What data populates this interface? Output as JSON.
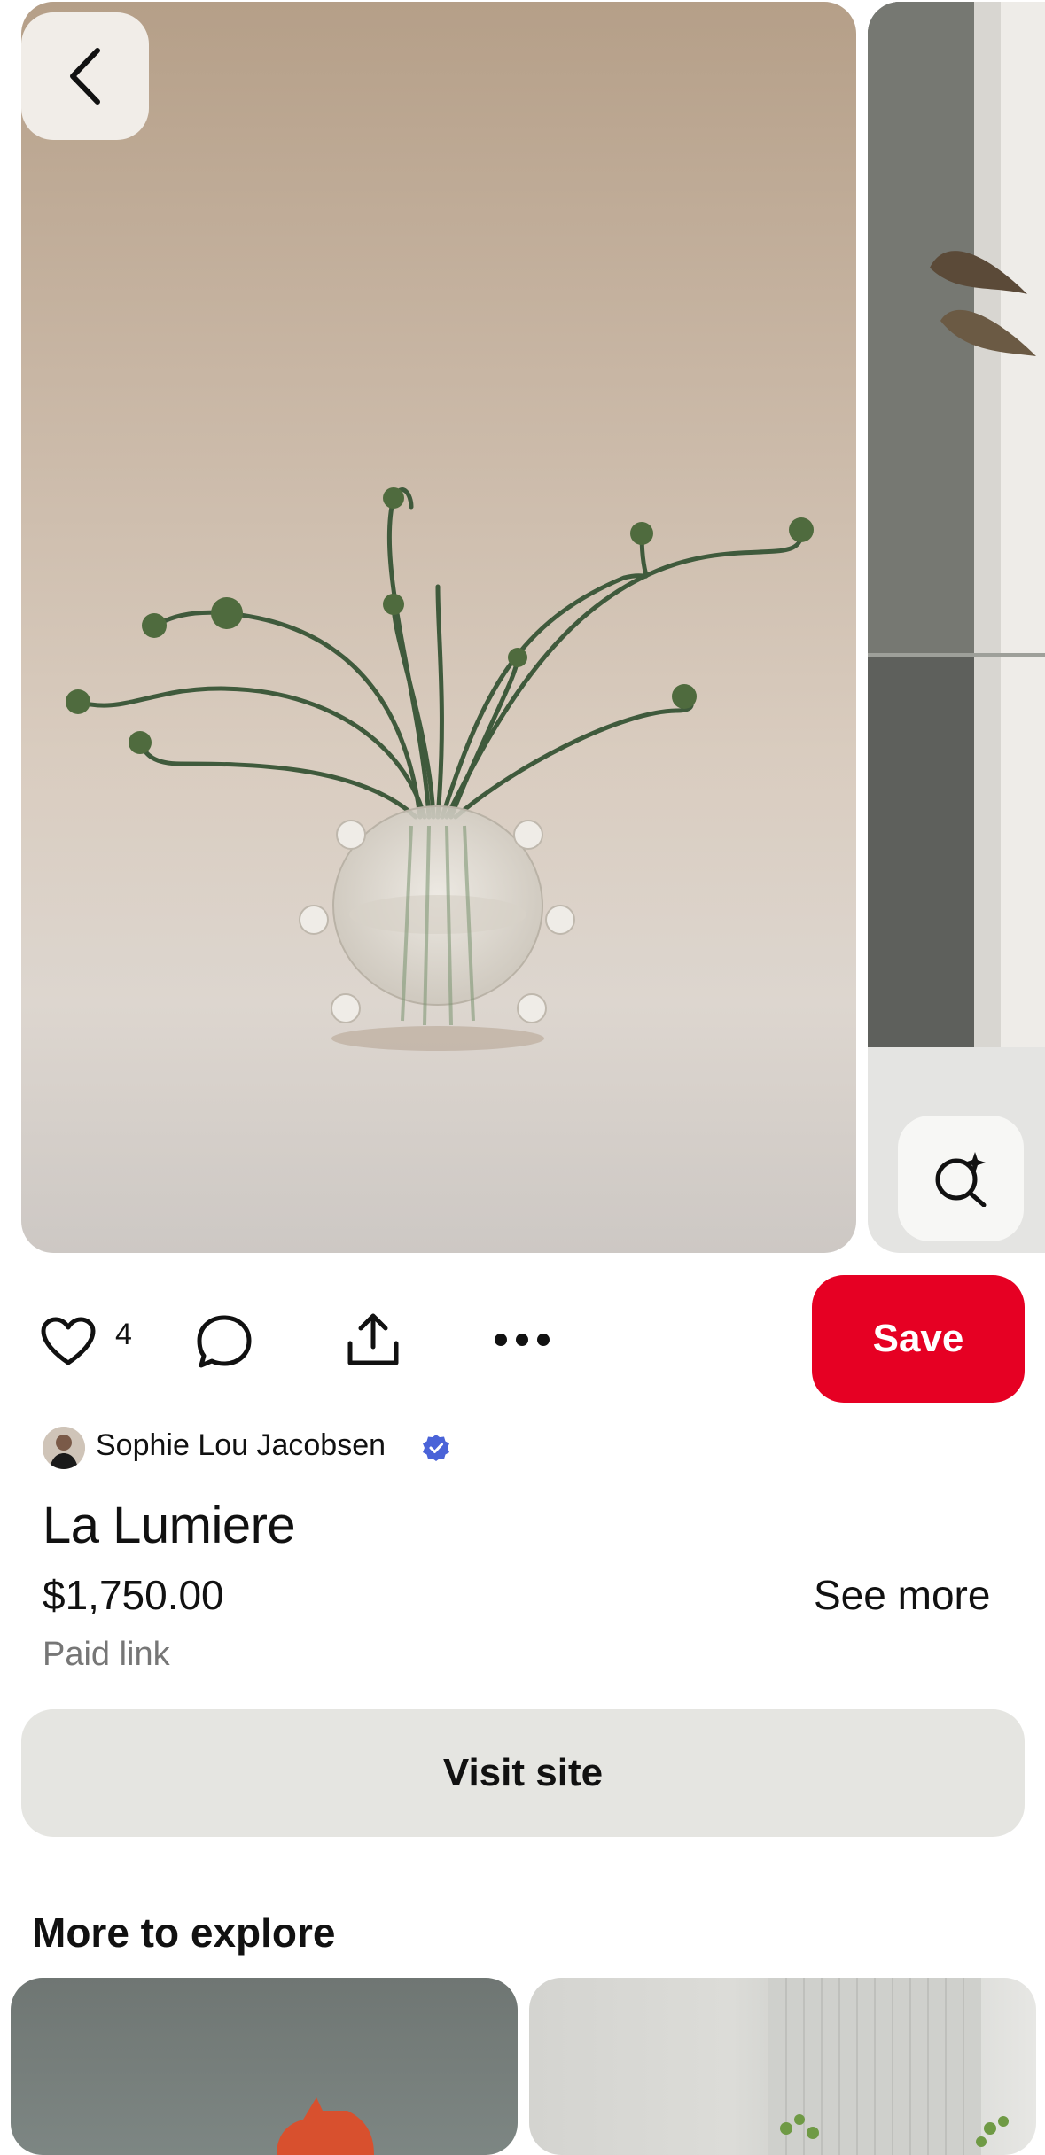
{
  "pin": {
    "like_count": "4",
    "save_label": "Save",
    "creator": {
      "name": "Sophie Lou Jacobsen",
      "verified": true
    },
    "title": "La Lumiere",
    "price": "$1,750.00",
    "see_more_label": "See more",
    "paid_link_label": "Paid link",
    "visit_label": "Visit site"
  },
  "explore": {
    "heading": "More to explore"
  },
  "icons": {
    "back": "chevron-left-icon",
    "lens": "visual-search-icon",
    "like": "heart-icon",
    "comment": "comment-icon",
    "share": "share-icon",
    "more": "more-icon",
    "verified": "verified-badge-icon"
  },
  "colors": {
    "save_button": "#e60023",
    "visit_button": "#e5e5e1",
    "verified_badge": "#4a63d8",
    "secondary_text": "#767676"
  }
}
